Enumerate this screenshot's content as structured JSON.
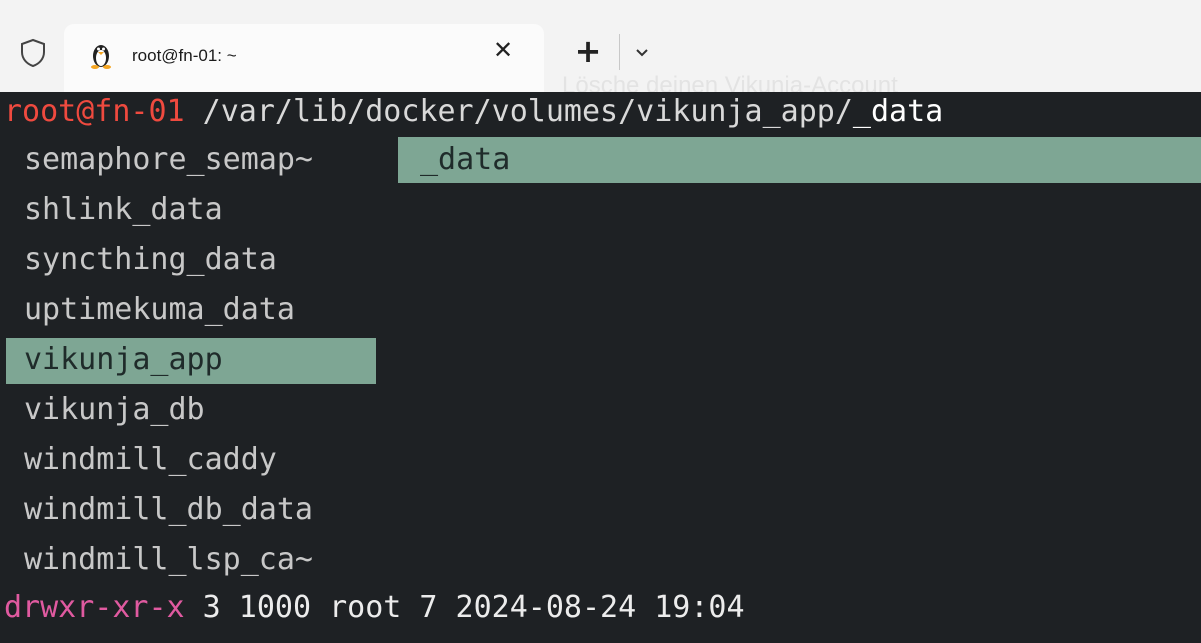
{
  "tabbar": {
    "shield_icon": "shield-icon",
    "tab": {
      "icon": "tux-icon",
      "title": "root@fn-01: ~",
      "close_label": "✕"
    },
    "new_tab_label": "+",
    "dropdown_icon": "chevron-down-icon"
  },
  "overlay_text": "Lösche deinen Vikunja-Account",
  "terminal": {
    "prompt": {
      "user_host": "root@fn-01",
      "path": " /var/lib/docker/volumes/vikunja_app/",
      "tail": "_data"
    },
    "left_column": [
      "semaphore_semap~",
      "shlink_data",
      "syncthing_data",
      "uptimekuma_data",
      "vikunja_app",
      "vikunja_db",
      "windmill_caddy",
      "windmill_db_data",
      "windmill_lsp_ca~"
    ],
    "right_column": [
      "_data"
    ],
    "status": {
      "permissions": "drwxr-xr-x",
      "details": " 3 1000 root 7 2024-08-24 19:04"
    }
  },
  "colors": {
    "background": "#1e2124",
    "prompt_user": "#ef4a3f",
    "selection": "#7ea694",
    "permissions": "#e05aa0"
  }
}
